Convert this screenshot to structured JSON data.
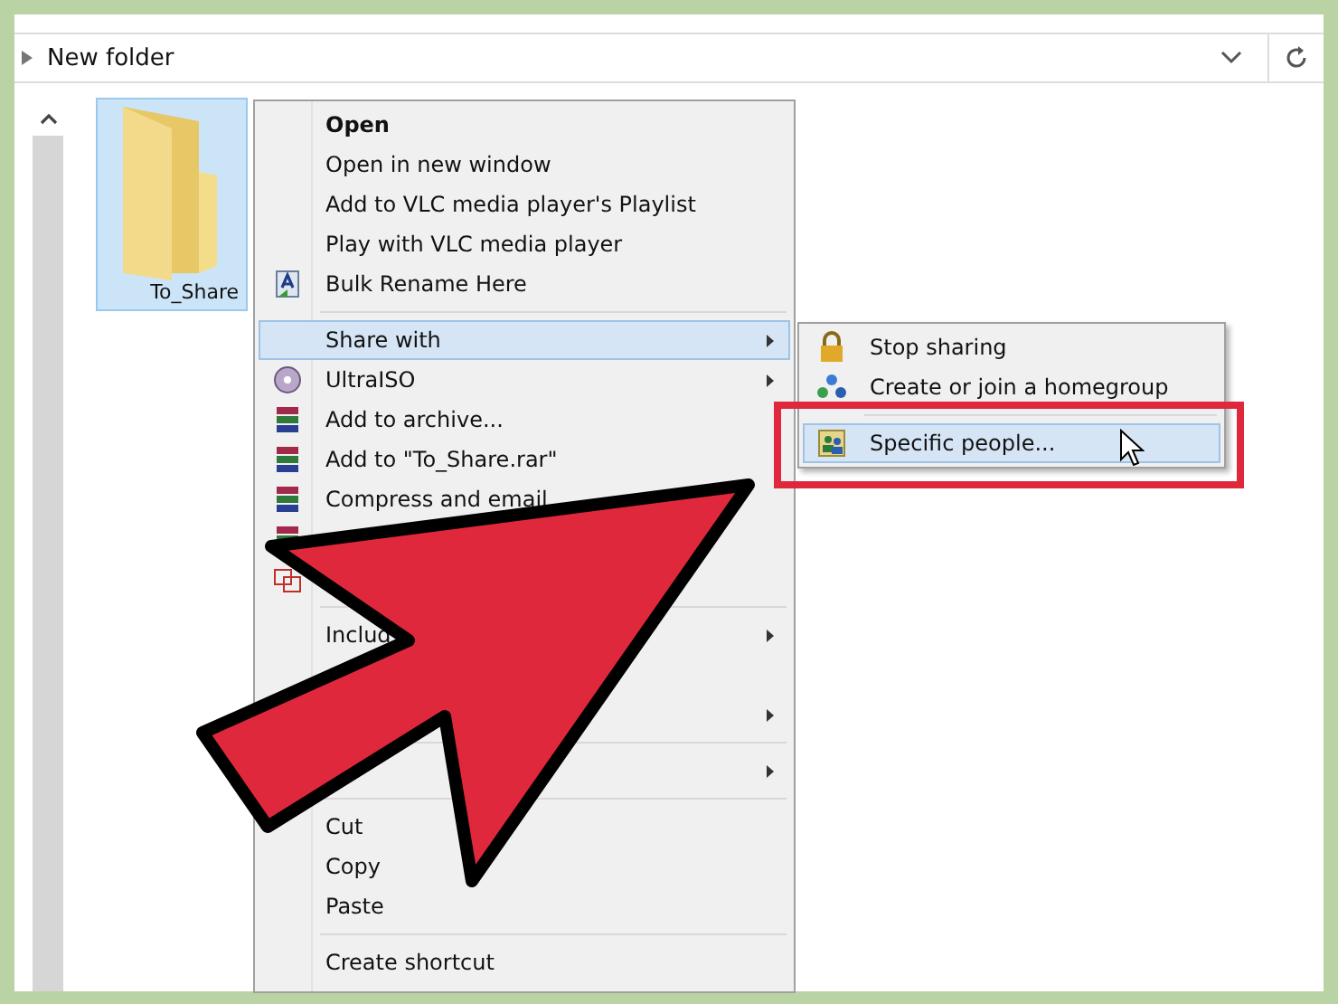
{
  "address_bar": {
    "path": "New folder"
  },
  "folder": {
    "name": "To_Share",
    "selected": true
  },
  "context_menu": {
    "items": [
      {
        "kind": "item",
        "label": "Open",
        "default": true,
        "selected": false,
        "submenu": false
      },
      {
        "kind": "item",
        "label": "Open in new window",
        "default": false,
        "selected": false,
        "submenu": false
      },
      {
        "kind": "item",
        "label": "Add to VLC media player's Playlist",
        "default": false,
        "selected": false,
        "submenu": false
      },
      {
        "kind": "item",
        "label": "Play with VLC media player",
        "default": false,
        "selected": false,
        "submenu": false
      },
      {
        "kind": "item",
        "label": "Bulk Rename Here",
        "default": false,
        "selected": false,
        "submenu": false
      },
      {
        "kind": "separator"
      },
      {
        "kind": "item",
        "label": "Share with",
        "default": false,
        "selected": true,
        "submenu": true
      },
      {
        "kind": "item",
        "label": "UltraISO",
        "default": false,
        "selected": false,
        "submenu": true
      },
      {
        "kind": "item",
        "label": "Add to archive...",
        "default": false,
        "selected": false,
        "submenu": false
      },
      {
        "kind": "item",
        "label": "Add to \"To_Share.rar\"",
        "default": false,
        "selected": false,
        "submenu": false
      },
      {
        "kind": "item",
        "label": "Compress and email",
        "default": false,
        "selected": false,
        "submenu": false
      },
      {
        "kind": "item",
        "selected": false,
        "submenu": false
      },
      {
        "kind": "item",
        "selected": false,
        "submenu": false
      },
      {
        "kind": "separator"
      },
      {
        "kind": "item",
        "label": "Includ",
        "default": false,
        "selected": false,
        "submenu": true
      },
      {
        "kind": "item",
        "selected": false,
        "submenu": false
      },
      {
        "kind": "item",
        "selected": false,
        "submenu": true
      },
      {
        "kind": "separator"
      },
      {
        "kind": "item",
        "selected": false,
        "submenu": true
      },
      {
        "kind": "separator"
      },
      {
        "kind": "item",
        "label": "Cut",
        "default": false,
        "selected": false,
        "submenu": false
      },
      {
        "kind": "item",
        "label": "Copy",
        "default": false,
        "selected": false,
        "submenu": false
      },
      {
        "kind": "item",
        "label": "Paste",
        "default": false,
        "selected": false,
        "submenu": false
      },
      {
        "kind": "separator"
      },
      {
        "kind": "item",
        "label": "Create shortcut",
        "default": false,
        "selected": false,
        "submenu": false
      }
    ]
  },
  "share_submenu": {
    "items": [
      {
        "kind": "item",
        "label": "Stop sharing",
        "selected": false
      },
      {
        "kind": "item",
        "label": "Create or join a homegroup",
        "selected": false
      },
      {
        "kind": "separator"
      },
      {
        "kind": "item",
        "label": "Specific people...",
        "selected": true
      }
    ]
  }
}
